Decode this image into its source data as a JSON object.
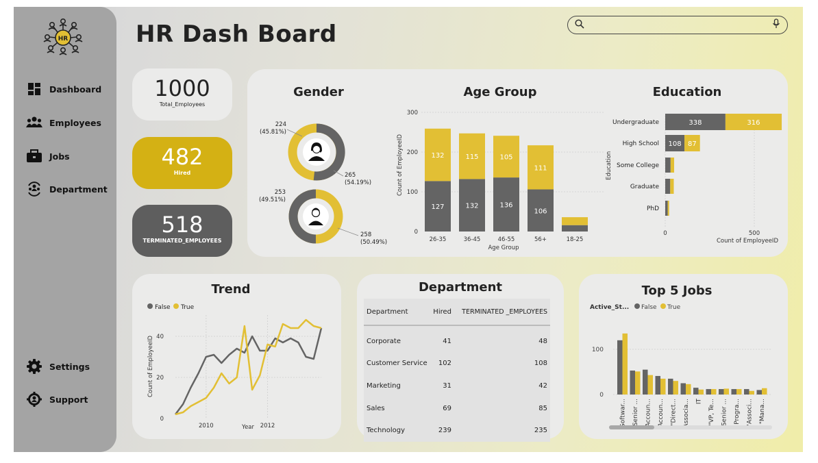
{
  "app": {
    "title": "HR Dash Board",
    "logo_text": "HR",
    "logo_icon": "hr-team-logo"
  },
  "sidebar": {
    "items": [
      {
        "label": "Dashboard",
        "icon": "dashboard-icon"
      },
      {
        "label": "Employees",
        "icon": "employees-icon"
      },
      {
        "label": "Jobs",
        "icon": "briefcase-icon"
      },
      {
        "label": "Department",
        "icon": "department-icon"
      },
      {
        "label": "Settings",
        "icon": "gear-icon"
      },
      {
        "label": "Support",
        "icon": "support-icon"
      }
    ]
  },
  "search": {
    "placeholder": "",
    "icons": [
      "search-icon",
      "microphone-icon"
    ]
  },
  "kpis": {
    "total": {
      "value": "1000",
      "label": "Total_Employees"
    },
    "hired": {
      "value": "482",
      "label": "Hired"
    },
    "terminated": {
      "value": "518",
      "label": "TERMINATED_EMPLOYEES"
    }
  },
  "colors": {
    "gold": "#e2bf34",
    "gray": "#646464",
    "hired_card": "#d4b114",
    "terminated_card": "#5e5e5e",
    "card_bg": "#ebebea"
  },
  "gender": {
    "title": "Gender",
    "female": {
      "left_value": "224",
      "left_pct": "(45.81%)",
      "right_value": "265",
      "right_pct": "(54.19%)"
    },
    "male": {
      "left_value": "253",
      "left_pct": "(49.51%)",
      "right_value": "258",
      "right_pct": "(50.49%)"
    }
  },
  "age_group": {
    "title": "Age Group",
    "x_title": "Age Group",
    "y_title": "Count of EmployeeID"
  },
  "education": {
    "title": "Education",
    "x_title": "Count of EmployeeID",
    "y_title": "Education"
  },
  "trend": {
    "title": "Trend",
    "x_title": "Year",
    "y_title": "Count of EmployeeID",
    "legend": [
      "False",
      "True"
    ]
  },
  "department": {
    "title": "Department",
    "columns": [
      "Department",
      "Hired",
      "TERMINATED _EMPLOYEES"
    ],
    "rows": [
      [
        "Corporate",
        "41",
        "48"
      ],
      [
        "Customer Service",
        "102",
        "108"
      ],
      [
        "Marketing",
        "31",
        "42"
      ],
      [
        "Sales",
        "69",
        "85"
      ],
      [
        "Technology",
        "239",
        "235"
      ]
    ]
  },
  "top_jobs": {
    "title": "Top 5 Jobs",
    "legend_title": "Active_St...",
    "legend": [
      "False",
      "True"
    ]
  },
  "chart_data": [
    {
      "type": "bar",
      "title": "Age Group",
      "xlabel": "Age Group",
      "ylabel": "Count of EmployeeID",
      "categories": [
        "26-35",
        "36-45",
        "46-55",
        "56+",
        "18-25"
      ],
      "series": [
        {
          "name": "False",
          "values": [
            127,
            132,
            136,
            106,
            16
          ]
        },
        {
          "name": "True",
          "values": [
            132,
            115,
            105,
            111,
            20
          ]
        }
      ],
      "stacked": true,
      "data_labels": [
        [
          "127",
          "132",
          "136",
          "106",
          ""
        ],
        [
          "132",
          "115",
          "105",
          "111",
          ""
        ]
      ],
      "ylim": [
        0,
        300
      ],
      "yticks": [
        0,
        100,
        200,
        300
      ]
    },
    {
      "type": "bar",
      "orientation": "horizontal",
      "title": "Education",
      "xlabel": "Count of EmployeeID",
      "ylabel": "Education",
      "categories": [
        "Undergraduate",
        "High School",
        "Some College",
        "Graduate",
        "PhD"
      ],
      "series": [
        {
          "name": "False",
          "values": [
            338,
            108,
            30,
            28,
            14
          ]
        },
        {
          "name": "True",
          "values": [
            316,
            87,
            20,
            20,
            8
          ]
        }
      ],
      "stacked": true,
      "data_labels": [
        [
          "338",
          "108",
          "",
          "",
          ""
        ],
        [
          "316",
          "87",
          "",
          "",
          ""
        ]
      ],
      "xlim": [
        0,
        700
      ],
      "xticks": [
        0,
        500
      ]
    },
    {
      "type": "line",
      "title": "Trend",
      "xlabel": "Year",
      "ylabel": "Count of EmployeeID",
      "x": [
        2009.0,
        2009.25,
        2009.5,
        2009.75,
        2010.0,
        2010.25,
        2010.5,
        2010.75,
        2011.0,
        2011.25,
        2011.5,
        2011.75,
        2012.0,
        2012.25,
        2012.5,
        2012.75,
        2013.0,
        2013.25,
        2013.5,
        2013.75
      ],
      "series": [
        {
          "name": "False",
          "values": [
            2,
            7,
            15,
            22,
            30,
            31,
            27,
            31,
            34,
            32,
            40,
            33,
            33,
            39,
            37,
            39,
            37,
            30,
            29,
            44
          ]
        },
        {
          "name": "True",
          "values": [
            2,
            3,
            6,
            8,
            10,
            15,
            22,
            17,
            20,
            45,
            14,
            21,
            36,
            35,
            46,
            44,
            44,
            48,
            45,
            44
          ]
        }
      ],
      "xticks": [
        2010,
        2012
      ],
      "ylim": [
        0,
        50
      ],
      "yticks": [
        0,
        20,
        40
      ],
      "legend": "top-left"
    },
    {
      "type": "bar",
      "title": "Top 5 Jobs",
      "categories": [
        "Softwar...",
        "Senior ...",
        "Accoun...",
        "Accoun...",
        "\"Direct...",
        "Associa...",
        "IT",
        "\"VP, Te...",
        "Senior ...",
        "Progra...",
        "\"Associ...",
        "\"Mana..."
      ],
      "series": [
        {
          "name": "False",
          "values": [
            120,
            53,
            55,
            41,
            35,
            25,
            15,
            12,
            12,
            12,
            12,
            10
          ]
        },
        {
          "name": "True",
          "values": [
            135,
            51,
            43,
            35,
            30,
            23,
            11,
            12,
            13,
            12,
            8,
            14
          ]
        }
      ],
      "ylim": [
        0,
        150
      ],
      "yticks": [
        0,
        100
      ],
      "legend": "top-left"
    }
  ]
}
